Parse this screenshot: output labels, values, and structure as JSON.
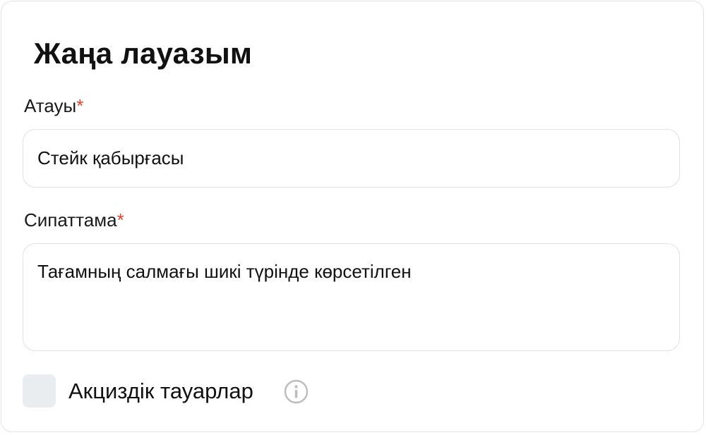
{
  "form": {
    "title": "Жаңа лауазым",
    "name_field": {
      "label": "Атауы",
      "required_mark": "*",
      "value": "Стейк қабырғасы"
    },
    "description_field": {
      "label": "Сипаттама",
      "required_mark": "*",
      "value": "Тағамның салмағы шикі түрінде көрсетілген"
    },
    "excise_checkbox": {
      "label": "Акциздік тауарлар",
      "checked": false,
      "info_icon": "info-icon"
    }
  },
  "colors": {
    "required": "#e0452b",
    "checkbox_bg": "#eaedf0",
    "border": "#e2e2e2",
    "icon": "#bdbdbd"
  }
}
